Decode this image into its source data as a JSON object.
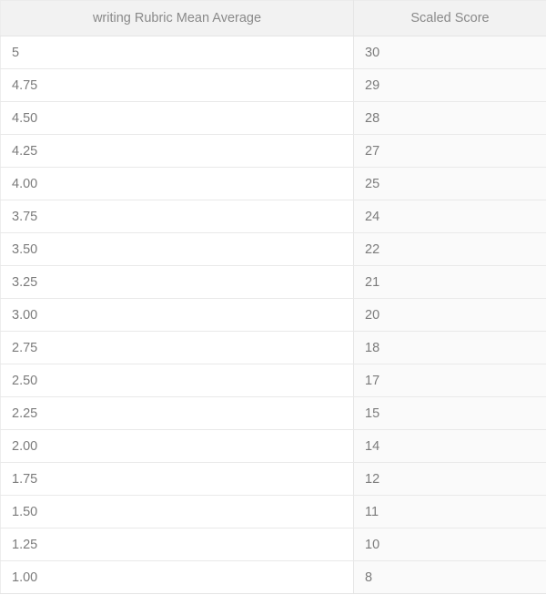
{
  "table": {
    "columns": [
      {
        "key": "rubric",
        "label": "writing Rubric Mean Average",
        "align": "center"
      },
      {
        "key": "scaled",
        "label": "Scaled Score",
        "align": "center"
      }
    ],
    "rows": [
      {
        "rubric": "5",
        "scaled": "30"
      },
      {
        "rubric": "4.75",
        "scaled": "29"
      },
      {
        "rubric": "4.50",
        "scaled": "28"
      },
      {
        "rubric": "4.25",
        "scaled": "27"
      },
      {
        "rubric": "4.00",
        "scaled": "25"
      },
      {
        "rubric": "3.75",
        "scaled": "24"
      },
      {
        "rubric": "3.50",
        "scaled": "22"
      },
      {
        "rubric": "3.25",
        "scaled": "21"
      },
      {
        "rubric": "3.00",
        "scaled": "20"
      },
      {
        "rubric": "2.75",
        "scaled": "18"
      },
      {
        "rubric": "2.50",
        "scaled": "17"
      },
      {
        "rubric": "2.25",
        "scaled": "15"
      },
      {
        "rubric": "2.00",
        "scaled": "14"
      },
      {
        "rubric": "1.75",
        "scaled": "12"
      },
      {
        "rubric": "1.50",
        "scaled": "11"
      },
      {
        "rubric": "1.25",
        "scaled": "10"
      },
      {
        "rubric": "1.00",
        "scaled": "8"
      }
    ]
  },
  "colors": {
    "header_background": "#f2f2f2",
    "header_text": "#8a8a8a",
    "body_text": "#7b7b7b",
    "row_divider": "#e9e9e9",
    "left_cell_background": "#ffffff",
    "right_cell_background": "#fafafa"
  },
  "chart_data": {
    "type": "table",
    "title": "",
    "columns": [
      "writing Rubric Mean Average",
      "Scaled Score"
    ],
    "x": [
      5,
      4.75,
      4.5,
      4.25,
      4.0,
      3.75,
      3.5,
      3.25,
      3.0,
      2.75,
      2.5,
      2.25,
      2.0,
      1.75,
      1.5,
      1.25,
      1.0
    ],
    "series": [
      {
        "name": "Scaled Score",
        "values": [
          30,
          29,
          28,
          27,
          25,
          24,
          22,
          21,
          20,
          18,
          17,
          15,
          14,
          12,
          11,
          10,
          8
        ]
      }
    ],
    "xlabel": "writing Rubric Mean Average",
    "ylabel": "Scaled Score",
    "xlim": [
      1.0,
      5.0
    ],
    "ylim": [
      8,
      30
    ],
    "grid": false,
    "legend": "none"
  }
}
